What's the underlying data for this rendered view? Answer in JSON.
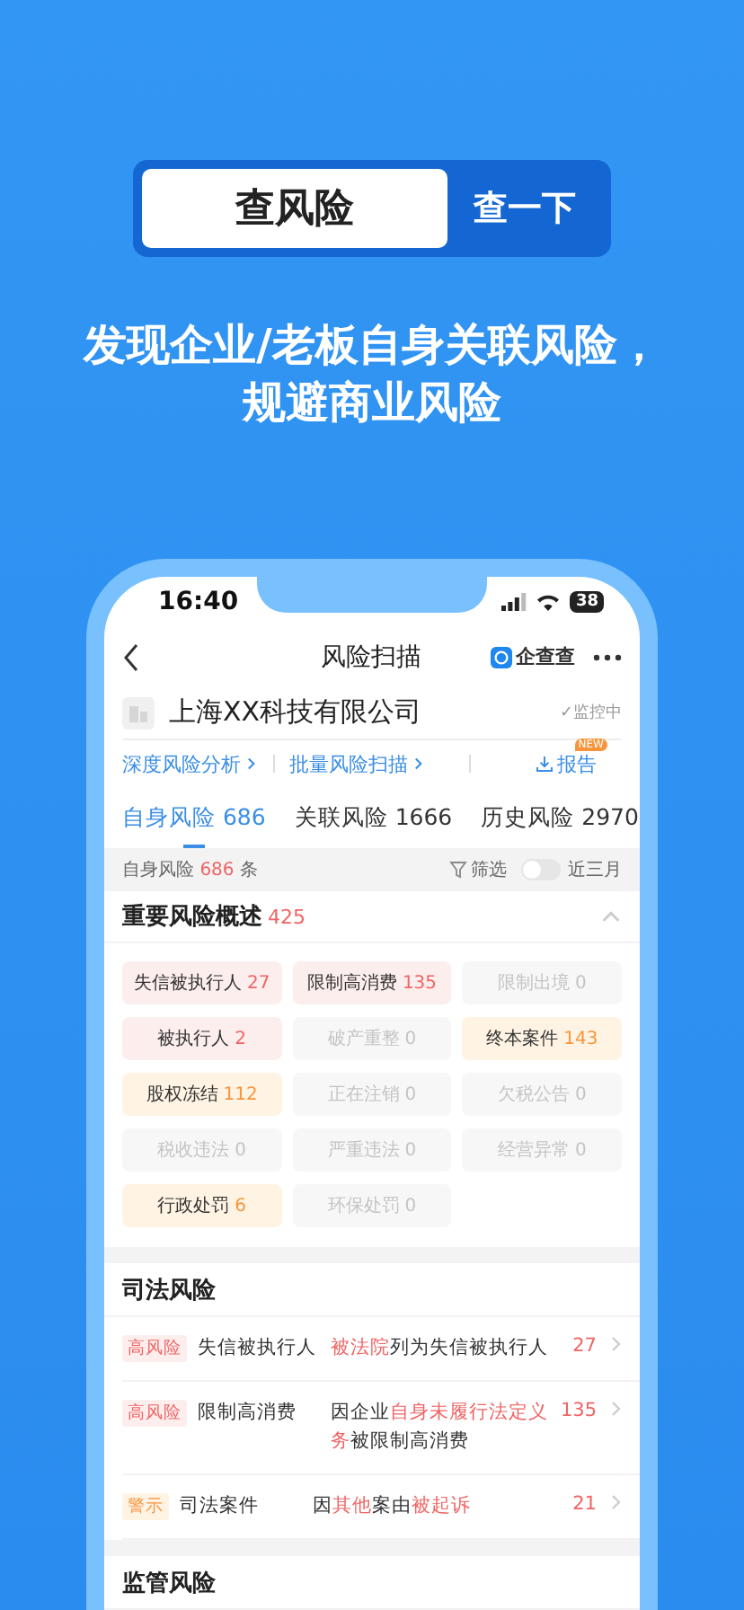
{
  "search_banner": {
    "query": "查风险",
    "button": "查一下"
  },
  "headline_lines": [
    "发现企业/老板自身关联风险，",
    "规避商业风险"
  ],
  "status_bar": {
    "time": "16:40",
    "battery": "38"
  },
  "nav": {
    "title": "风险扫描",
    "brand": "企查查"
  },
  "company": {
    "name": "上海XX科技有限公司",
    "monitor": "✓监控中"
  },
  "links": [
    {
      "label": "深度风险分析",
      "kind": "link"
    },
    {
      "label": "批量风险扫描",
      "kind": "link"
    },
    {
      "label": "报告",
      "kind": "report",
      "badge": "NEW"
    }
  ],
  "tabs": [
    {
      "label": "自身风险",
      "count": "686",
      "selected": true
    },
    {
      "label": "关联风险",
      "count": "1666",
      "selected": false
    },
    {
      "label": "历史风险",
      "count": "2970",
      "selected": false
    }
  ],
  "filter_bar": {
    "label": "自身风险",
    "count": "686",
    "unit": "条",
    "filter": "筛选",
    "toggle_label": "近三月",
    "toggle_on": false
  },
  "overview": {
    "title": "重要风险概述",
    "count": "425",
    "expanded": true,
    "chips": [
      {
        "label": "失信被执行人",
        "count": "27",
        "kind": "high"
      },
      {
        "label": "限制高消费",
        "count": "135",
        "kind": "high"
      },
      {
        "label": "限制出境",
        "count": "0",
        "kind": "none"
      },
      {
        "label": "被执行人",
        "count": "2",
        "kind": "high"
      },
      {
        "label": "破产重整",
        "count": "0",
        "kind": "none"
      },
      {
        "label": "终本案件",
        "count": "143",
        "kind": "warn"
      },
      {
        "label": "股权冻结",
        "count": "112",
        "kind": "warn"
      },
      {
        "label": "正在注销",
        "count": "0",
        "kind": "none"
      },
      {
        "label": "欠税公告",
        "count": "0",
        "kind": "none"
      },
      {
        "label": "税收违法",
        "count": "0",
        "kind": "none"
      },
      {
        "label": "严重违法",
        "count": "0",
        "kind": "none"
      },
      {
        "label": "经营异常",
        "count": "0",
        "kind": "none"
      },
      {
        "label": "行政处罚",
        "count": "6",
        "kind": "warn"
      },
      {
        "label": "环保处罚",
        "count": "0",
        "kind": "none"
      }
    ]
  },
  "judicial": {
    "title": "司法风险",
    "rows": [
      {
        "tag": "高风险",
        "kind": "high",
        "type": "失信被执行人",
        "count": "27",
        "description": [
          {
            "text": "被法院",
            "highlight": true
          },
          {
            "text": "列为失信被执行人",
            "highlight": false
          }
        ]
      },
      {
        "tag": "高风险",
        "kind": "high",
        "type": "限制高消费",
        "count": "135",
        "description": [
          {
            "text": "因企业",
            "highlight": false
          },
          {
            "text": "自身未履行法定义务",
            "highlight": true
          },
          {
            "text": "被限制高消费",
            "highlight": false
          }
        ]
      },
      {
        "tag": "警示",
        "kind": "warn",
        "type": "司法案件",
        "count": "21",
        "description": [
          {
            "text": "因",
            "highlight": false
          },
          {
            "text": "其他",
            "highlight": true
          },
          {
            "text": "案由",
            "highlight": false
          },
          {
            "text": "被起诉",
            "highlight": true
          }
        ]
      }
    ]
  },
  "next_section": {
    "title": "监管风险"
  }
}
